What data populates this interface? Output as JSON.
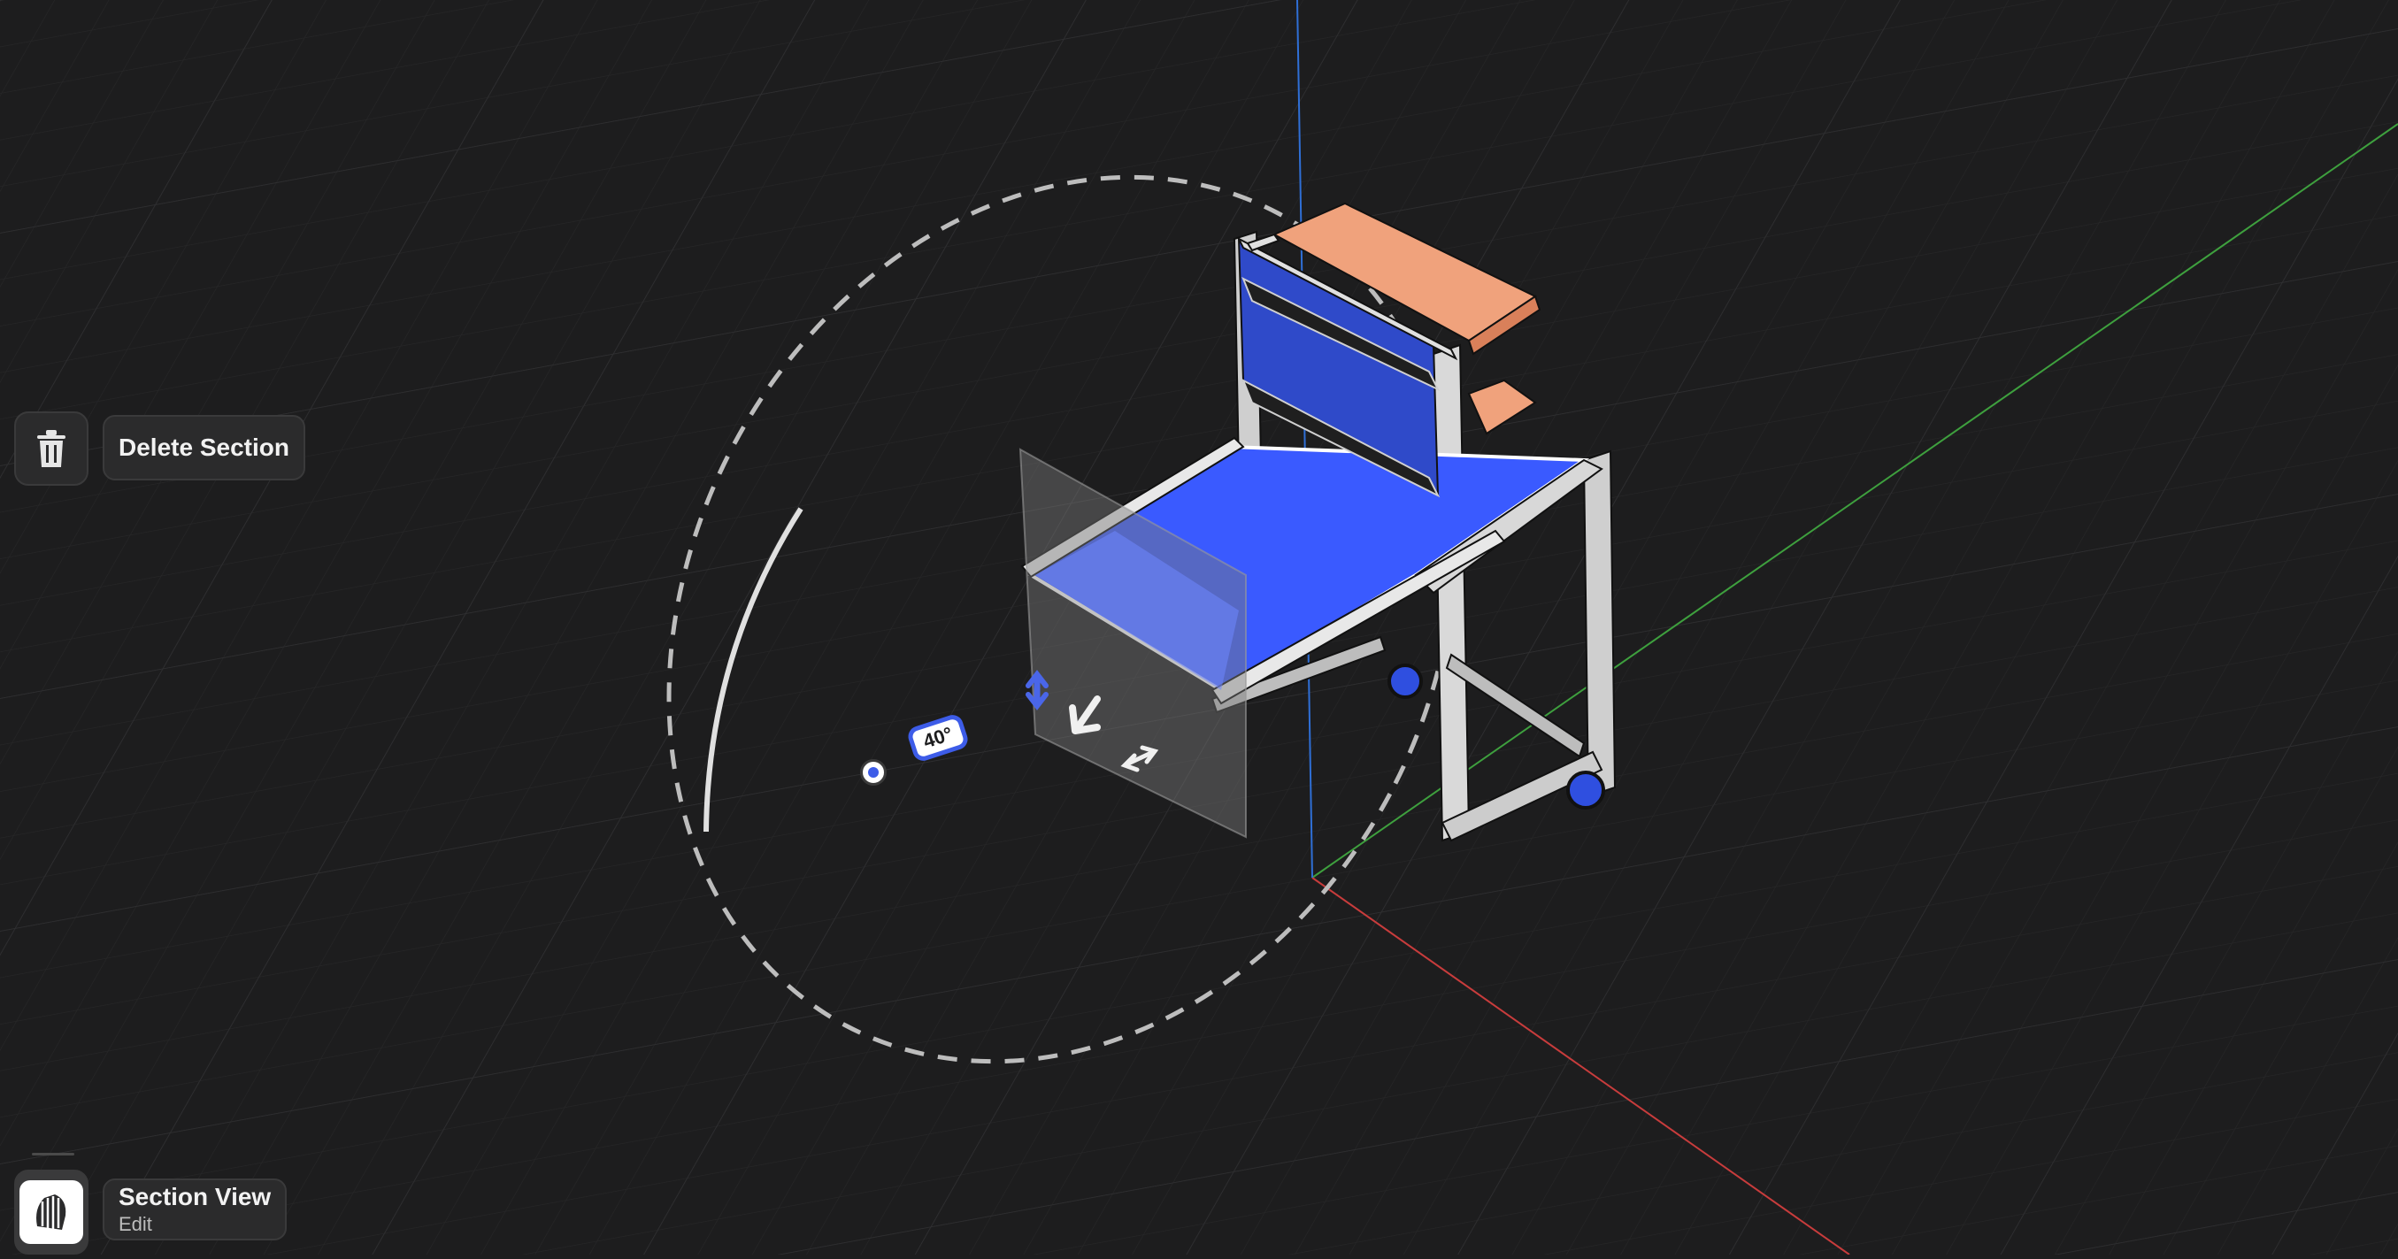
{
  "toolbar": {
    "delete_section": {
      "label": "Delete Section",
      "icon": "trash-icon"
    },
    "section_view": {
      "label": "Section View",
      "sublabel": "Edit",
      "icon": "section-view-icon"
    }
  },
  "gizmo": {
    "angle_label": "40°"
  },
  "colors": {
    "background": "#1d1d1e",
    "grid": "#2a2a2b",
    "axis_x": "#c83c3c",
    "axis_y": "#3ea03e",
    "axis_z": "#2f6fd6",
    "accent": "#3d5ce8",
    "panel_blue": "#3a5aff",
    "shelf_orange": "#f0a27c"
  }
}
